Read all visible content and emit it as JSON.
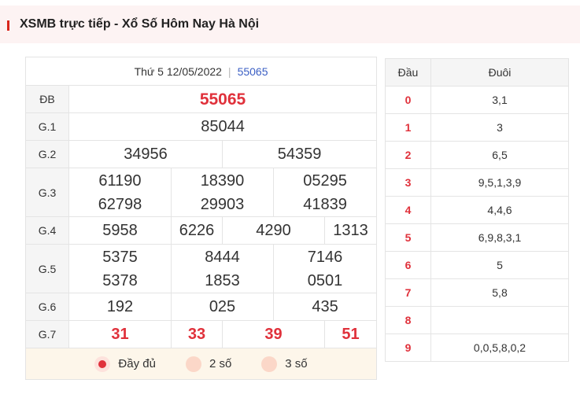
{
  "header": {
    "title": "XSMB trực tiếp - Xổ Số Hôm Nay Hà Nội"
  },
  "results": {
    "date": "Thứ 5 12/05/2022",
    "code": "55065",
    "special": {
      "label": "ĐB",
      "value": "55065"
    },
    "g1": {
      "label": "G.1",
      "values": [
        "85044"
      ]
    },
    "g2": {
      "label": "G.2",
      "values": [
        "34956",
        "54359"
      ]
    },
    "g3": {
      "label": "G.3",
      "values": [
        "61190",
        "18390",
        "05295",
        "62798",
        "29903",
        "41839"
      ]
    },
    "g4": {
      "label": "G.4",
      "values": [
        "5958",
        "6226",
        "4290",
        "1313"
      ]
    },
    "g5": {
      "label": "G.5",
      "values": [
        "5375",
        "8444",
        "7146",
        "5378",
        "1853",
        "0501"
      ]
    },
    "g6": {
      "label": "G.6",
      "values": [
        "192",
        "025",
        "435"
      ]
    },
    "g7": {
      "label": "G.7",
      "values": [
        "31",
        "33",
        "39",
        "51"
      ]
    }
  },
  "modes": [
    {
      "label": "Đầy đủ",
      "selected": true
    },
    {
      "label": "2 số",
      "selected": false
    },
    {
      "label": "3 số",
      "selected": false
    }
  ],
  "loto": {
    "headers": [
      "Đầu",
      "Đuôi"
    ],
    "rows": [
      {
        "dau": "0",
        "duoi": "3,1"
      },
      {
        "dau": "1",
        "duoi": "3"
      },
      {
        "dau": "2",
        "duoi": "6,5"
      },
      {
        "dau": "3",
        "duoi": "9,5,1,3,9"
      },
      {
        "dau": "4",
        "duoi": "4,4,6"
      },
      {
        "dau": "5",
        "duoi": "6,9,8,3,1"
      },
      {
        "dau": "6",
        "duoi": "5"
      },
      {
        "dau": "7",
        "duoi": "5,8"
      },
      {
        "dau": "8",
        "duoi": ""
      },
      {
        "dau": "9",
        "duoi": "0,0,5,8,0,2"
      }
    ]
  },
  "colors": {
    "accent": "#e0313b",
    "code": "#3b5fc4",
    "header_bg": "#fdf3f3",
    "mode_bg": "#fdf6ea"
  }
}
